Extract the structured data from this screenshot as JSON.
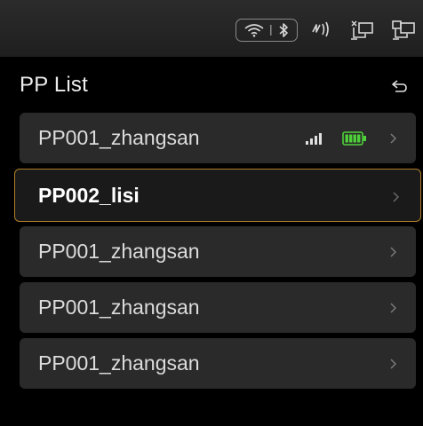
{
  "status_bar": {
    "icons": [
      "wifi-icon",
      "bluetooth-icon",
      "nfc-icon",
      "network-disconnected-icon",
      "network-connected-icon"
    ]
  },
  "header": {
    "title": "PP List",
    "back_icon": "back-arrow-icon"
  },
  "pp_list": {
    "items": [
      {
        "label": "PP001_zhangsan",
        "selected": false,
        "show_status": true,
        "signal_icon": "signal-strength-icon",
        "battery_icon": "battery-full-icon"
      },
      {
        "label": "PP002_lisi",
        "selected": true,
        "show_status": false
      },
      {
        "label": "PP001_zhangsan",
        "selected": false,
        "show_status": false
      },
      {
        "label": "PP001_zhangsan",
        "selected": false,
        "show_status": false
      },
      {
        "label": "PP001_zhangsan",
        "selected": false,
        "show_status": false
      }
    ]
  },
  "colors": {
    "background": "#000000",
    "item_background": "#2a2a2a",
    "selected_border": "#b07e28",
    "battery_green": "#4fd13a"
  }
}
